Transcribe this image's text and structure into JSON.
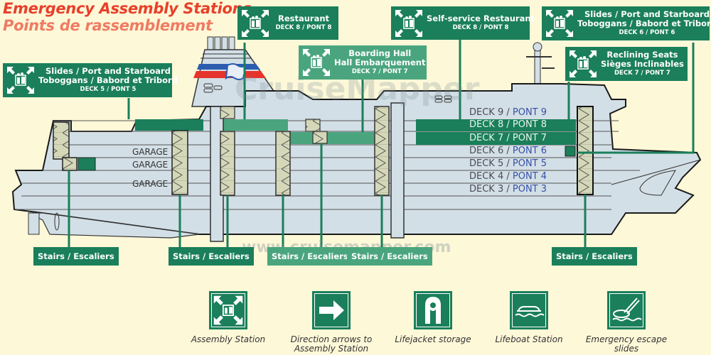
{
  "header": {
    "title_en": "Emergency Assembly Stations",
    "title_fr": "Points de rassemblement"
  },
  "watermark": {
    "logo": "CruiseMapper",
    "url": "www.cruisemapper.com"
  },
  "colors": {
    "callout_green": "#1a7f5a",
    "callout_light_green": "#4aa57e",
    "title_red": "#e8402a",
    "title_salmon": "#f07b63",
    "pont_blue": "#3550a8",
    "hull_grey": "#d3dfe6",
    "background": "#fdf8d8"
  },
  "callouts": [
    {
      "id": "slides-deck5",
      "line1": "Slides / Port and Starboard",
      "line2": "Toboggans / Babord et Tribord",
      "deck": "DECK 5 / PONT 5",
      "icon": "assembly-station-icon"
    },
    {
      "id": "restaurant",
      "line1": "Restaurant",
      "line2": "",
      "deck": "DECK 8 / PONT 8",
      "icon": "assembly-station-icon"
    },
    {
      "id": "boarding-hall",
      "line1": "Boarding Hall",
      "line2": "Hall Embarquement",
      "deck": "DECK 7 / PONT 7",
      "icon": "assembly-station-icon"
    },
    {
      "id": "self-service",
      "line1": "Self-service Restaurant",
      "line2": "",
      "deck": "DECK 8 / PONT 8",
      "icon": "assembly-station-icon"
    },
    {
      "id": "slides-deck6",
      "line1": "Slides / Port and Starboard",
      "line2": "Toboggans / Babord et Tribord",
      "deck": "DECK 6 / PONT 6",
      "icon": "assembly-station-icon"
    },
    {
      "id": "reclining-seats",
      "line1": "Reclining Seats",
      "line2": "Sièges Inclinables",
      "deck": "DECK 7 / PONT 7",
      "icon": "assembly-station-icon"
    }
  ],
  "decks": [
    {
      "deck": "DECK 9 /",
      "pont": "PONT 9",
      "highlight": false
    },
    {
      "deck": "DECK 8 /",
      "pont": "PONT 8",
      "highlight": true
    },
    {
      "deck": "DECK 7 /",
      "pont": "PONT 7",
      "highlight": true
    },
    {
      "deck": "DECK 6 /",
      "pont": "PONT 6",
      "highlight": false
    },
    {
      "deck": "DECK 5 /",
      "pont": "PONT 5",
      "highlight": false
    },
    {
      "deck": "DECK 4 /",
      "pont": "PONT 4",
      "highlight": false
    },
    {
      "deck": "DECK 3 /",
      "pont": "PONT 3",
      "highlight": false
    }
  ],
  "garages": [
    "GARAGE",
    "GARAGE",
    "GARAGE"
  ],
  "stairs": [
    {
      "label": "Stairs / Escaliers"
    },
    {
      "label": "Stairs / Escaliers"
    },
    {
      "label": "Stairs / Escaliers"
    },
    {
      "label": "Stairs / Escaliers"
    },
    {
      "label": "Stairs / Escaliers"
    }
  ],
  "legend": [
    {
      "icon": "assembly-station-icon",
      "label": "Assembly Station"
    },
    {
      "icon": "direction-arrow-icon",
      "label": "Direction arrows to Assembly Station"
    },
    {
      "icon": "lifejacket-icon",
      "label": "Lifejacket storage"
    },
    {
      "icon": "lifeboat-icon",
      "label": "Lifeboat Station"
    },
    {
      "icon": "escape-slide-icon",
      "label": "Emergency escape slides"
    }
  ]
}
